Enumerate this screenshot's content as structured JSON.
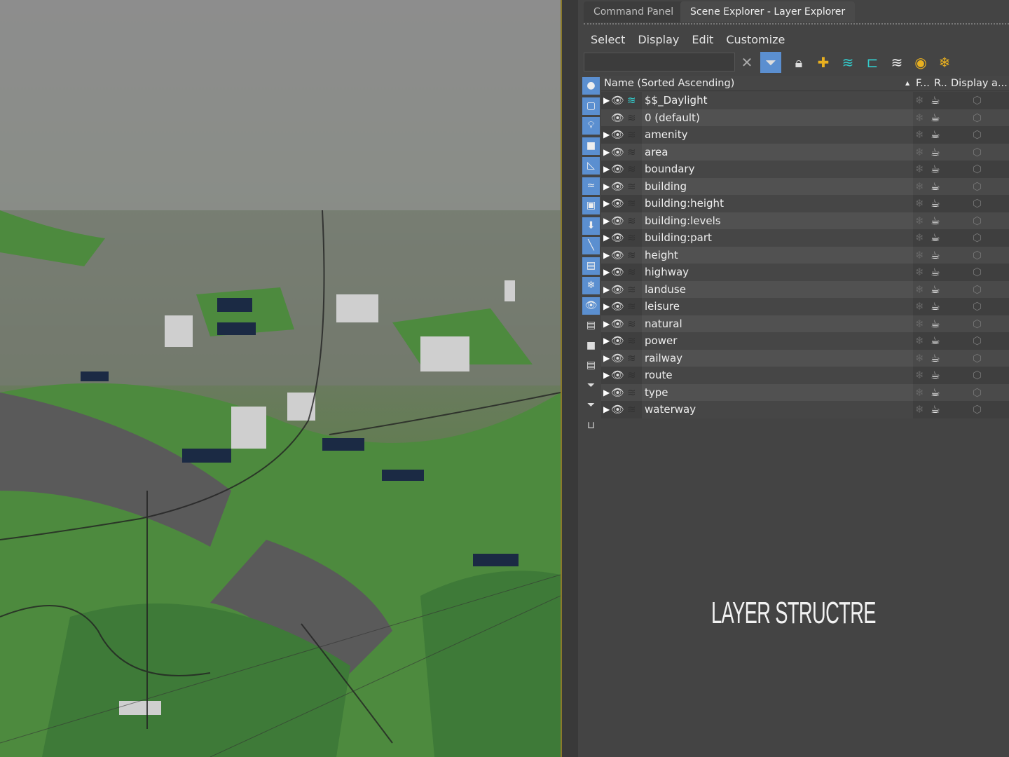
{
  "tabs": [
    {
      "label": "Command Panel",
      "active": false
    },
    {
      "label": "Scene Explorer - Layer Explorer",
      "active": true
    }
  ],
  "menu": [
    "Select",
    "Display",
    "Edit",
    "Customize"
  ],
  "search": {
    "value": "",
    "placeholder": ""
  },
  "columns": {
    "name": "Name (Sorted Ascending)",
    "freeze": "F...",
    "render": "R..",
    "display": "Display a..."
  },
  "layers": [
    "$$_Daylight",
    "0 (default)",
    "amenity",
    "area",
    "boundary",
    "building",
    "building:height",
    "building:levels",
    "building:part",
    "height",
    "highway",
    "landuse",
    "leisure",
    "natural",
    "power",
    "railway",
    "route",
    "type",
    "waterway"
  ],
  "overlay_title": "LAYER STRUCTRE",
  "colors": {
    "accent": "#5b8fd0",
    "active_layer": "#33cccc"
  }
}
